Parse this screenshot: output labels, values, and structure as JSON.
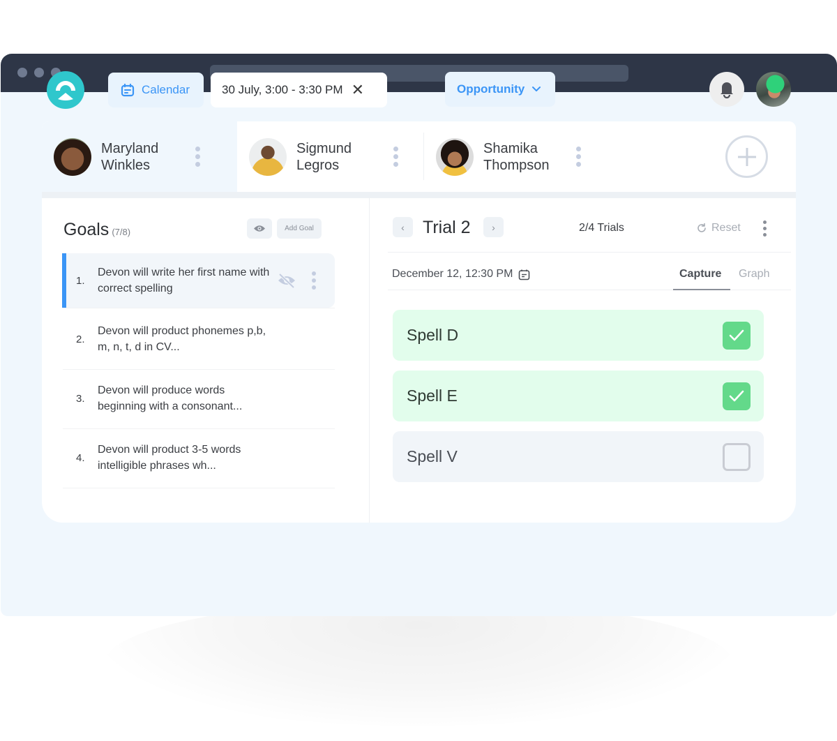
{
  "header": {
    "calendar_label": "Calendar",
    "session_time": "30 July, 3:00 - 3:30 PM",
    "opportunity_label": "Opportunity"
  },
  "students": [
    {
      "first": "Maryland",
      "last": "Winkles",
      "active": true
    },
    {
      "first": "Sigmund",
      "last": "Legros",
      "active": false
    },
    {
      "first": "Shamika",
      "last": "Thompson",
      "active": false
    }
  ],
  "goals": {
    "title": "Goals",
    "count": "(7/8)",
    "add_goal_label": "Add Goal",
    "items": [
      {
        "num": "1.",
        "text": "Devon will write her first name with correct spelling",
        "active": true
      },
      {
        "num": "2.",
        "text": "Devon will product phonemes p,b, m, n, t, d in CV...",
        "active": false
      },
      {
        "num": "3.",
        "text": "Devon will produce words beginning with a consonant...",
        "active": false
      },
      {
        "num": "4.",
        "text": "Devon will product 3-5 words intelligible phrases wh...",
        "active": false
      }
    ]
  },
  "trial": {
    "title": "Trial 2",
    "count": "2/4 Trials",
    "reset_label": "Reset",
    "date": "December 12, 12:30 PM",
    "tabs": [
      {
        "label": "Capture",
        "active": true
      },
      {
        "label": "Graph",
        "active": false
      }
    ],
    "items": [
      {
        "label": "Spell D",
        "checked": true
      },
      {
        "label": "Spell E",
        "checked": true
      },
      {
        "label": "Spell V",
        "checked": false
      }
    ]
  },
  "colors": {
    "accent": "#3b95f6",
    "brand": "#2fc7cc",
    "success": "#63d98a",
    "success_bg": "#e2fdec"
  }
}
